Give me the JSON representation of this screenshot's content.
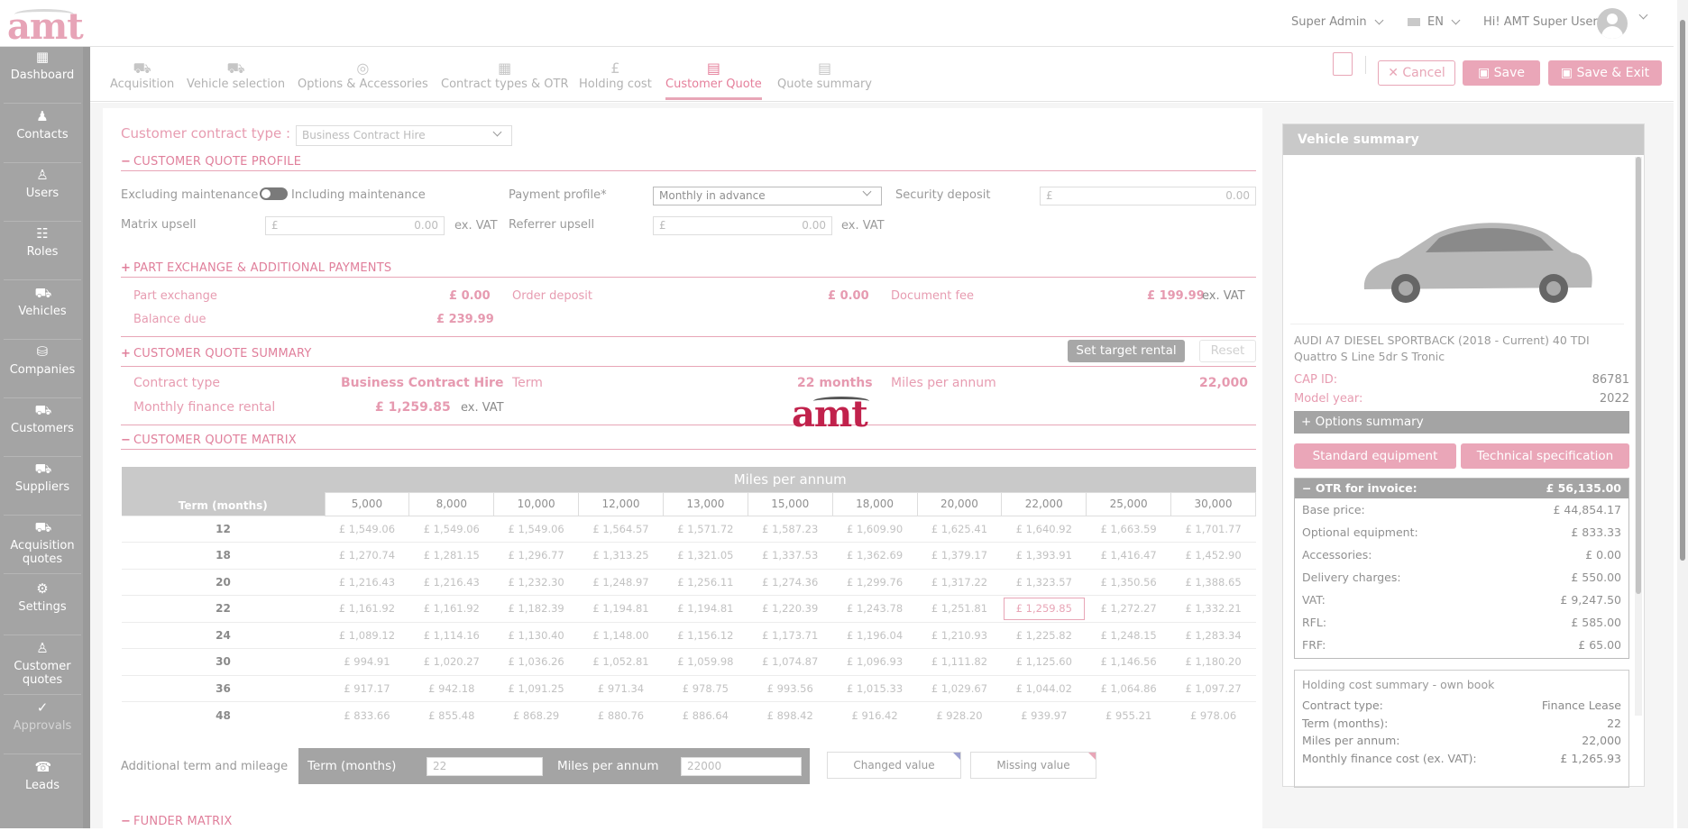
{
  "app": {
    "logo": "amt",
    "watermark_logo": "amt"
  },
  "header": {
    "role": "Super Admin",
    "language": "EN",
    "greeting": "Hi! AMT Super User"
  },
  "sidebar": {
    "items": [
      {
        "label": "Dashboard",
        "icon": "dashboard-icon"
      },
      {
        "label": "Contacts",
        "icon": "contacts-icon"
      },
      {
        "label": "Users",
        "icon": "user-icon"
      },
      {
        "label": "Roles",
        "icon": "roles-icon"
      },
      {
        "label": "Vehicles",
        "icon": "car-icon"
      },
      {
        "label": "Companies",
        "icon": "companies-icon"
      },
      {
        "label": "Customers",
        "icon": "customers-icon"
      },
      {
        "label": "Suppliers",
        "icon": "suppliers-icon"
      },
      {
        "label": "Acquisition quotes",
        "icon": "acquisition-icon"
      },
      {
        "label": "Settings",
        "icon": "gear-icon"
      },
      {
        "label": "Customer quotes",
        "icon": "customer-quotes-icon"
      },
      {
        "label": "Approvals",
        "icon": "check-icon"
      },
      {
        "label": "Leads",
        "icon": "leads-icon"
      }
    ]
  },
  "tabs": [
    {
      "label": "Acquisition"
    },
    {
      "label": "Vehicle selection"
    },
    {
      "label": "Options & Accessories"
    },
    {
      "label": "Contract types & OTR"
    },
    {
      "label": "Holding cost"
    },
    {
      "label": "Customer Quote"
    },
    {
      "label": "Quote summary"
    }
  ],
  "toolbar": {
    "cancel": "Cancel",
    "save": "Save",
    "save_exit": "Save & Exit"
  },
  "form": {
    "contract_type_label": "Customer contract type :",
    "contract_type_value": "Business Contract Hire",
    "profile_section": "CUSTOMER QUOTE PROFILE",
    "excluding": "Excluding maintenance",
    "including": "Including maintenance",
    "payment_profile_label": "Payment profile*",
    "payment_profile_value": "Monthly in advance",
    "security_deposit_label": "Security deposit",
    "security_deposit_value": "0.00",
    "matrix_upsell_label": "Matrix upsell",
    "matrix_upsell_value": "0.00",
    "referrer_upsell_label": "Referrer upsell",
    "referrer_upsell_value": "0.00",
    "currency": "£",
    "ex_vat": "ex. VAT"
  },
  "part_exchange": {
    "section": "PART EXCHANGE & ADDITIONAL PAYMENTS",
    "part_exchange_label": "Part exchange",
    "part_exchange_value": "£ 0.00",
    "order_deposit_label": "Order deposit",
    "order_deposit_value": "£ 0.00",
    "document_fee_label": "Document fee",
    "document_fee_value": "£ 199.99",
    "balance_due_label": "Balance due",
    "balance_due_value": "£ 239.99"
  },
  "summary": {
    "section": "CUSTOMER QUOTE SUMMARY",
    "set_target": "Set target rental",
    "reset": "Reset",
    "contract_type_label": "Contract type",
    "contract_type_value": "Business Contract Hire",
    "term_label": "Term",
    "term_value": "22 months",
    "miles_label": "Miles per annum",
    "miles_value": "22,000",
    "rental_label": "Monthly finance rental",
    "rental_value": "£ 1,259.85"
  },
  "matrix": {
    "section": "CUSTOMER QUOTE MATRIX",
    "title": "Miles per annum",
    "term_header": "Term (months)",
    "miles": [
      "5,000",
      "8,000",
      "10,000",
      "12,000",
      "13,000",
      "15,000",
      "18,000",
      "20,000",
      "22,000",
      "25,000",
      "30,000"
    ],
    "rows": [
      {
        "term": "12",
        "values": [
          "£ 1,549.06",
          "£ 1,549.06",
          "£ 1,549.06",
          "£ 1,564.57",
          "£ 1,571.72",
          "£ 1,587.23",
          "£ 1,609.90",
          "£ 1,625.41",
          "£ 1,640.92",
          "£ 1,663.59",
          "£ 1,701.77"
        ]
      },
      {
        "term": "18",
        "values": [
          "£ 1,270.74",
          "£ 1,281.15",
          "£ 1,296.77",
          "£ 1,313.25",
          "£ 1,321.05",
          "£ 1,337.53",
          "£ 1,362.69",
          "£ 1,379.17",
          "£ 1,393.91",
          "£ 1,416.47",
          "£ 1,452.90"
        ]
      },
      {
        "term": "20",
        "values": [
          "£ 1,216.43",
          "£ 1,216.43",
          "£ 1,232.30",
          "£ 1,248.97",
          "£ 1,256.11",
          "£ 1,274.36",
          "£ 1,299.76",
          "£ 1,317.22",
          "£ 1,323.57",
          "£ 1,350.56",
          "£ 1,388.65"
        ]
      },
      {
        "term": "22",
        "values": [
          "£ 1,161.92",
          "£ 1,161.92",
          "£ 1,182.39",
          "£ 1,194.81",
          "£ 1,194.81",
          "£ 1,220.39",
          "£ 1,243.78",
          "£ 1,251.81",
          "£ 1,259.85",
          "£ 1,272.27",
          "£ 1,332.21"
        ]
      },
      {
        "term": "24",
        "values": [
          "£ 1,089.12",
          "£ 1,114.16",
          "£ 1,130.40",
          "£ 1,148.00",
          "£ 1,156.12",
          "£ 1,173.71",
          "£ 1,196.04",
          "£ 1,210.93",
          "£ 1,225.82",
          "£ 1,248.15",
          "£ 1,283.34"
        ]
      },
      {
        "term": "30",
        "values": [
          "£ 994.91",
          "£ 1,020.27",
          "£ 1,036.26",
          "£ 1,052.81",
          "£ 1,059.98",
          "£ 1,074.87",
          "£ 1,096.93",
          "£ 1,111.82",
          "£ 1,125.60",
          "£ 1,146.56",
          "£ 1,180.20"
        ]
      },
      {
        "term": "36",
        "values": [
          "£ 917.17",
          "£ 942.18",
          "£ 1,091.25",
          "£ 971.34",
          "£ 978.75",
          "£ 993.56",
          "£ 1,015.33",
          "£ 1,029.67",
          "£ 1,044.02",
          "£ 1,064.86",
          "£ 1,097.27"
        ]
      },
      {
        "term": "48",
        "values": [
          "£ 833.66",
          "£ 855.48",
          "£ 868.29",
          "£ 880.76",
          "£ 886.64",
          "£ 898.42",
          "£ 916.42",
          "£ 928.20",
          "£ 939.97",
          "£ 955.21",
          "£ 978.06"
        ]
      }
    ],
    "highlight_row": 3,
    "highlight_col": 8
  },
  "additional": {
    "label": "Additional term and mileage",
    "term_label": "Term (months)",
    "term_value": "22",
    "miles_label": "Miles per annum",
    "miles_value": "22000",
    "changed": "Changed value",
    "missing": "Missing value"
  },
  "funder_section": "FUNDER MATRIX",
  "vehicle_summary": {
    "title": "Vehicle summary",
    "name": "AUDI A7 DIESEL SPORTBACK (2018 - Current) 40 TDI Quattro S Line 5dr S Tronic",
    "cap_id_label": "CAP ID:",
    "cap_id": "86781",
    "model_year_label": "Model year:",
    "model_year": "2022",
    "options_summary": "Options summary",
    "standard_equipment": "Standard equipment",
    "technical_spec": "Technical specification",
    "otr_label": "OTR for invoice:",
    "otr_value": "£ 56,135.00",
    "otr_lines": [
      {
        "label": "Base price:",
        "value": "£ 44,854.17"
      },
      {
        "label": "Optional equipment:",
        "value": "£ 833.33"
      },
      {
        "label": "Accessories:",
        "value": "£ 0.00"
      },
      {
        "label": "Delivery charges:",
        "value": "£ 550.00"
      },
      {
        "label": "VAT:",
        "value": "£ 9,247.50"
      },
      {
        "label": "RFL:",
        "value": "£ 585.00"
      },
      {
        "label": "FRF:",
        "value": "£ 65.00"
      }
    ],
    "holding_title": "Holding cost summary - own book",
    "holding_lines": [
      {
        "label": "Contract type:",
        "value": "Finance Lease"
      },
      {
        "label": "Term (months):",
        "value": "22"
      },
      {
        "label": "Miles per annum:",
        "value": "22,000"
      },
      {
        "label": "Monthly finance cost (ex. VAT):",
        "value": "£ 1,265.93"
      }
    ]
  }
}
